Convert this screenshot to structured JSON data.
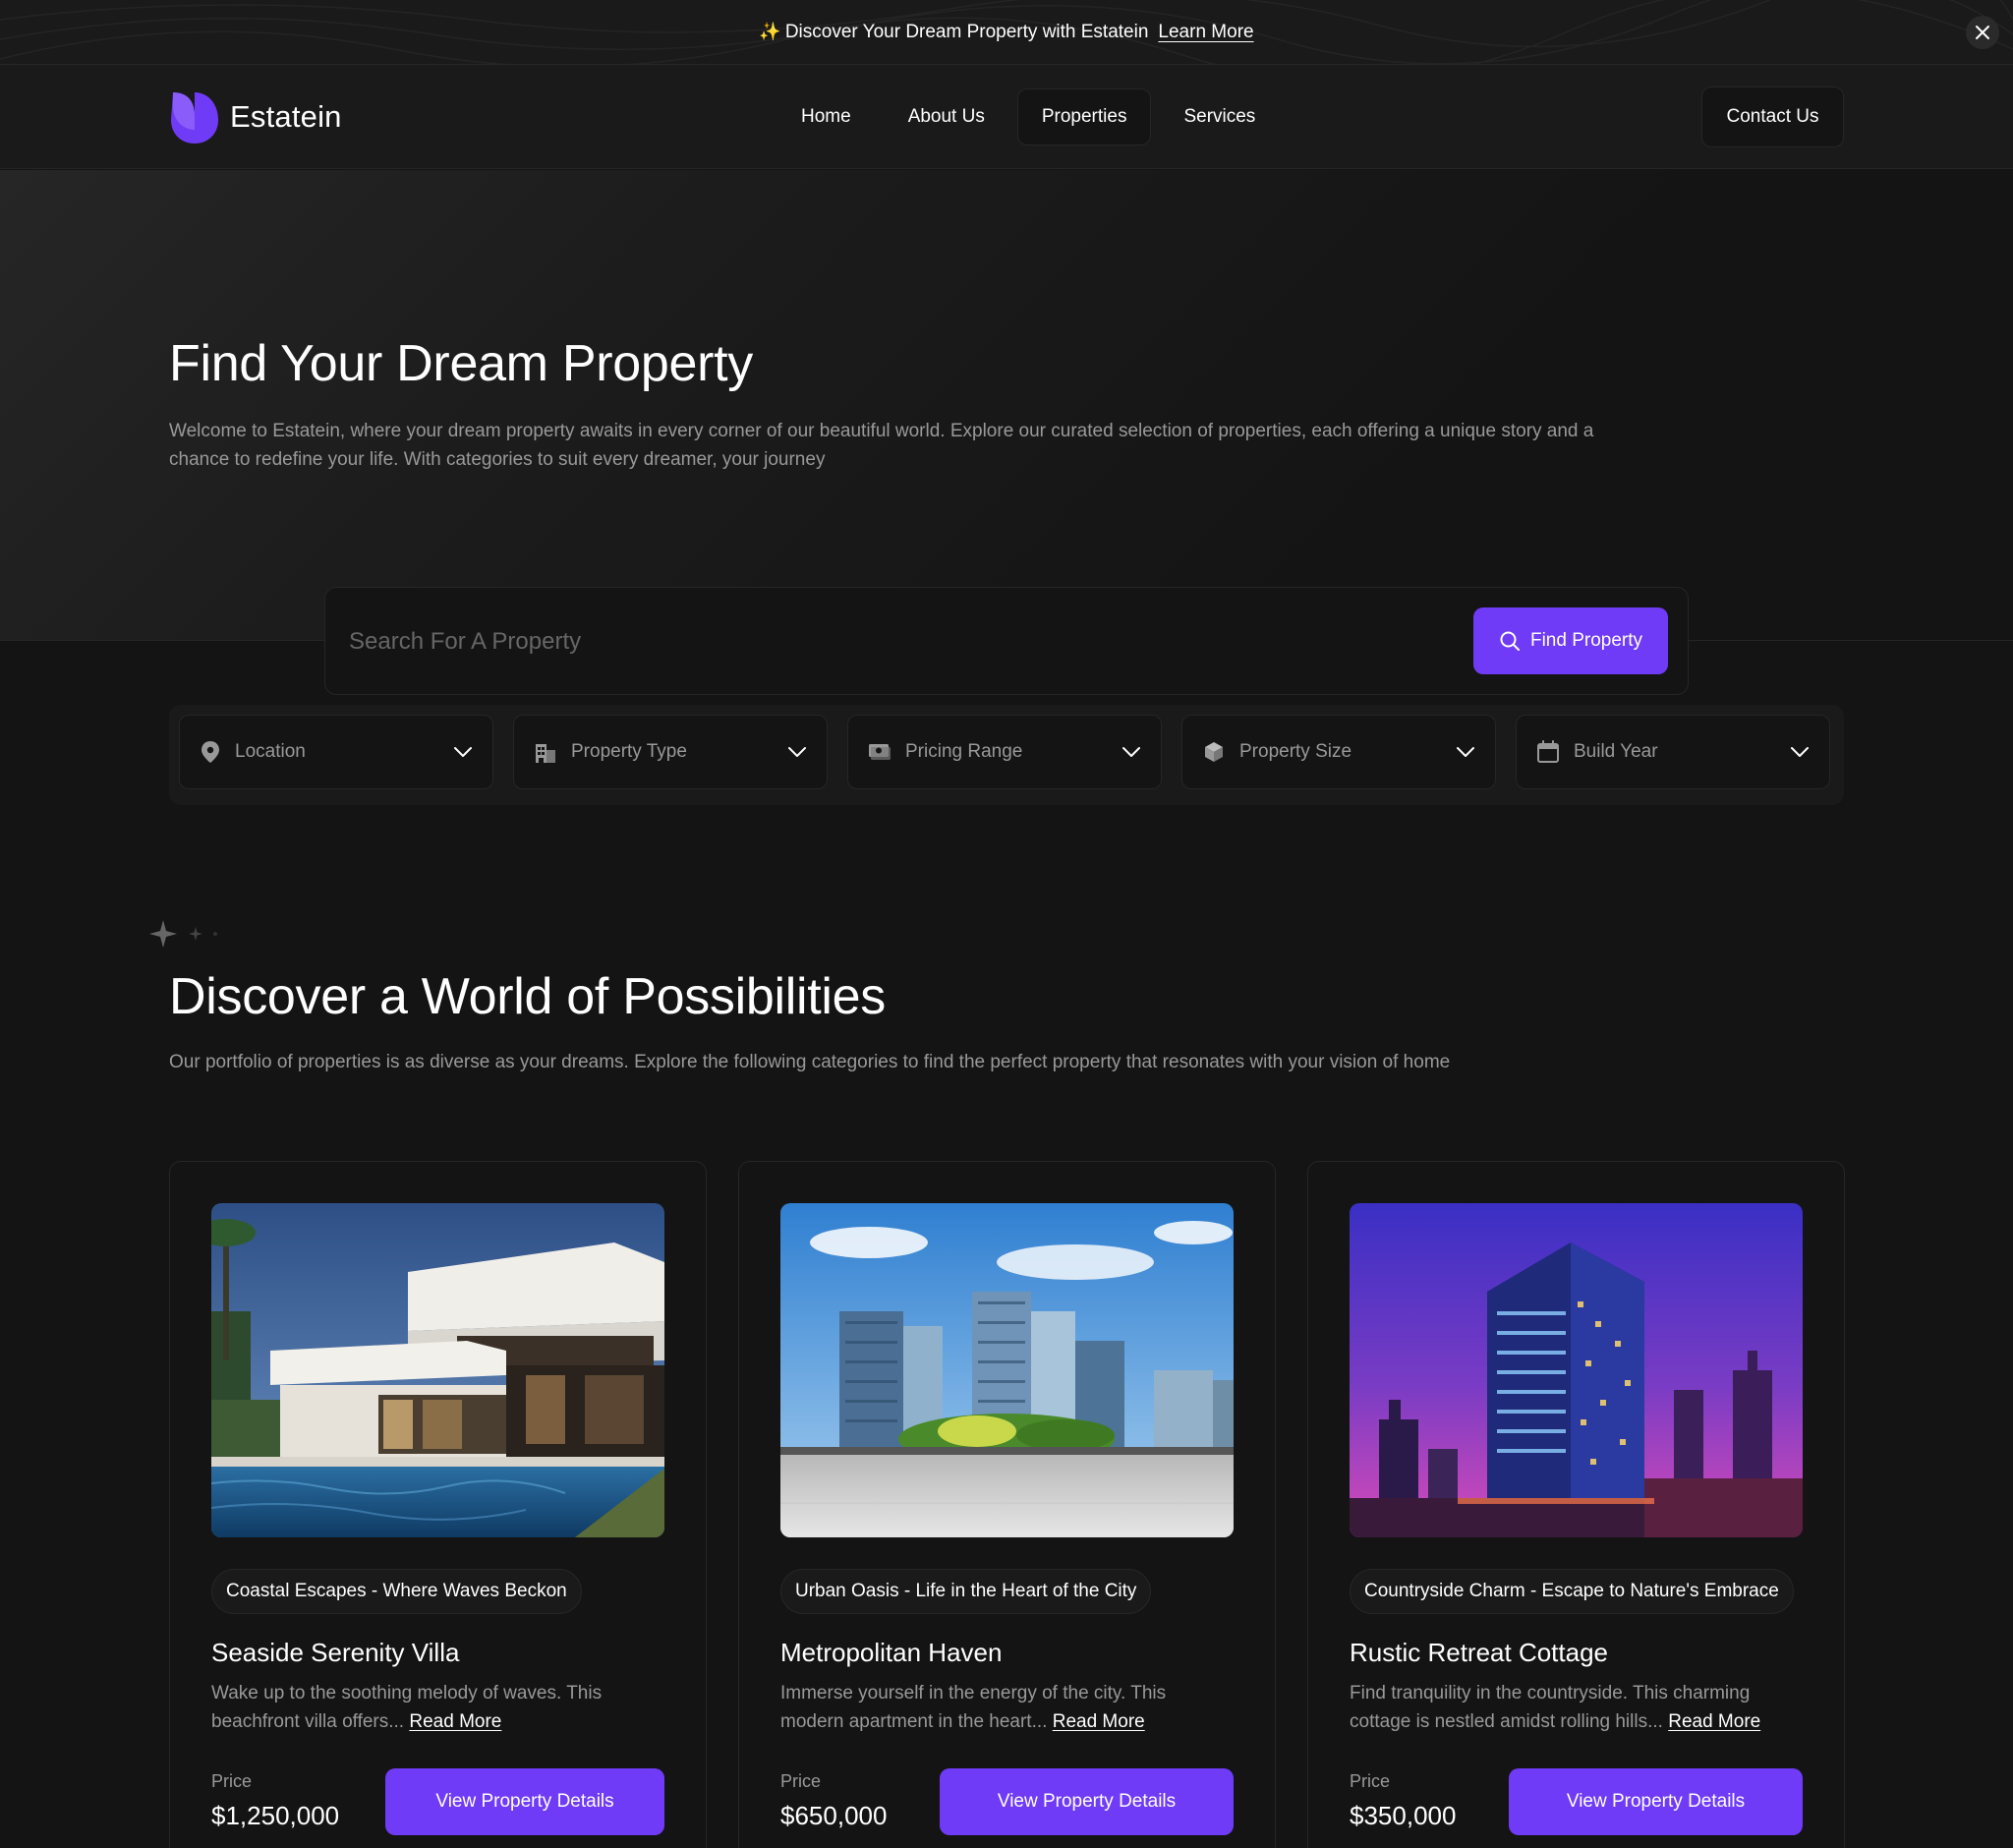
{
  "announcement": {
    "sparkle": "✨",
    "text": "Discover Your Dream Property with Estatein",
    "link": "Learn More"
  },
  "brand": {
    "name": "Estatein",
    "accent": "#703bf7"
  },
  "nav": {
    "items": [
      {
        "label": "Home",
        "active": false
      },
      {
        "label": "About Us",
        "active": false
      },
      {
        "label": "Properties",
        "active": true
      },
      {
        "label": "Services",
        "active": false
      }
    ],
    "contact": "Contact Us"
  },
  "hero": {
    "title": "Find Your Dream Property",
    "description": "Welcome to Estatein, where your dream property awaits in every corner of our beautiful world. Explore our curated selection of properties, each offering a unique story and a chance to redefine your life. With categories to suit every dreamer, your journey"
  },
  "search": {
    "placeholder": "Search For A Property",
    "button": "Find Property"
  },
  "filters": [
    {
      "label": "Location",
      "icon": "location-pin-icon"
    },
    {
      "label": "Property Type",
      "icon": "building-icon"
    },
    {
      "label": "Pricing Range",
      "icon": "money-icon"
    },
    {
      "label": "Property Size",
      "icon": "cube-icon"
    },
    {
      "label": "Build Year",
      "icon": "calendar-icon"
    }
  ],
  "section": {
    "title": "Discover a World of Possibilities",
    "description": "Our portfolio of properties is as diverse as your dreams. Explore the following categories to find the perfect property that resonates with your vision of home"
  },
  "cards": [
    {
      "tag": "Coastal Escapes - Where Waves Beckon",
      "title": "Seaside Serenity Villa",
      "description": "Wake up to the soothing melody of waves. This beachfront villa offers...",
      "read_more": "Read More",
      "price_label": "Price",
      "price": "$1,250,000",
      "button": "View Property Details"
    },
    {
      "tag": "Urban Oasis - Life in the Heart of the City",
      "title": "Metropolitan Haven",
      "description": "Immerse yourself in the energy of the city. This modern apartment in the heart...",
      "read_more": "Read More",
      "price_label": "Price",
      "price": "$650,000",
      "button": "View Property Details"
    },
    {
      "tag": "Countryside Charm - Escape to Nature's Embrace",
      "title": "Rustic Retreat Cottage",
      "description": "Find tranquility in the countryside. This charming cottage is nestled amidst rolling hills...",
      "read_more": "Read More",
      "price_label": "Price",
      "price": "$350,000",
      "button": "View Property Details"
    }
  ]
}
